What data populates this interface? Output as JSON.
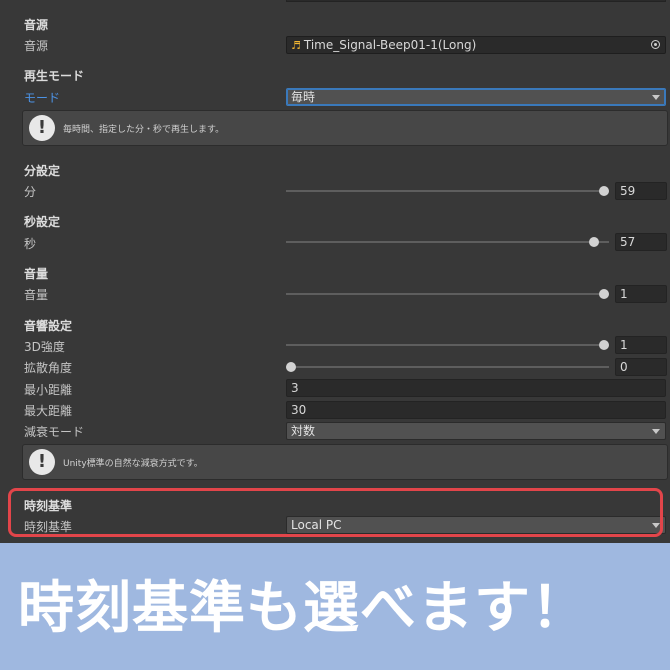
{
  "audio_source": {
    "header": "音源",
    "label": "音源",
    "value": "Time_Signal-Beep01-1(Long)"
  },
  "play_mode": {
    "header": "再生モード",
    "label": "モード",
    "value": "毎時",
    "help": "毎時間、指定した分・秒で再生します。"
  },
  "minute": {
    "header": "分設定",
    "label": "分",
    "value": "59"
  },
  "second": {
    "header": "秒設定",
    "label": "秒",
    "value": "57"
  },
  "volume": {
    "header": "音量",
    "label": "音量",
    "value": "1"
  },
  "sound_settings": {
    "header": "音響設定",
    "spatial_label": "3D強度",
    "spatial_value": "1",
    "spread_label": "拡散角度",
    "spread_value": "0",
    "min_label": "最小距離",
    "min_value": "3",
    "max_label": "最大距離",
    "max_value": "30",
    "rolloff_label": "減衰モード",
    "rolloff_value": "対数",
    "help": "Unity標準の自然な減衰方式です。"
  },
  "time_base": {
    "header": "時刻基準",
    "label": "時刻基準",
    "value": "Local PC"
  },
  "banner": {
    "text": "時刻基準も選べます！"
  }
}
